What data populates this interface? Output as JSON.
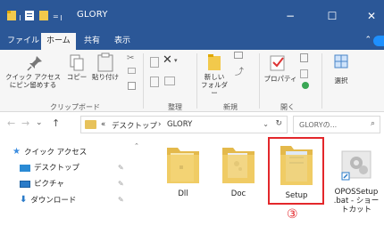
{
  "window": {
    "title": "GLORY",
    "minimize": "−",
    "maximize": "☐",
    "close": "✕"
  },
  "tabs": [
    "ファイル",
    "ホーム",
    "共有",
    "表示"
  ],
  "ribbon": {
    "clipboard": {
      "pin_label_1": "クイック アクセス",
      "pin_label_2": "にピン留めする",
      "copy_label": "コピー",
      "paste_label": "貼り付け",
      "group_label": "クリップボード"
    },
    "organize": {
      "group_label": "整理"
    },
    "new": {
      "folder_label_1": "新しい",
      "folder_label_2": "フォルダー",
      "group_label": "新規"
    },
    "open": {
      "properties_label": "プロパティ",
      "group_label": "開く"
    },
    "select": {
      "label": "選択"
    }
  },
  "address": {
    "back": "←",
    "forward": "→",
    "recent": "⌄",
    "up": "↑",
    "overflow": "«",
    "crumbs": [
      "デスクトップ",
      "GLORY"
    ],
    "separator": "›",
    "dropdown": "⌄",
    "refresh": "↻",
    "search_placeholder": "GLORYの...",
    "search_icon": "⌕"
  },
  "nav": {
    "items": [
      {
        "label": "クイック アクセス",
        "icon": "star-icon"
      },
      {
        "label": "デスクトップ",
        "icon": "desktop-icon"
      },
      {
        "label": "ピクチャ",
        "icon": "pictures-icon"
      },
      {
        "label": "ダウンロード",
        "icon": "download-icon"
      }
    ],
    "pin_glyph": "✎"
  },
  "files": [
    {
      "name": "Dll",
      "type": "folder"
    },
    {
      "name": "Doc",
      "type": "folder"
    },
    {
      "name": "Setup",
      "type": "folder",
      "selected": true
    },
    {
      "name_line1": "OPOSSetup",
      "name_line2": ".bat - ショー",
      "name_line3": "トカット",
      "type": "shortcut"
    }
  ],
  "annotation": {
    "step": "③"
  },
  "colors": {
    "titlebar": "#2b5797",
    "highlight": "#e3272b",
    "folder": "#e7c25b"
  }
}
